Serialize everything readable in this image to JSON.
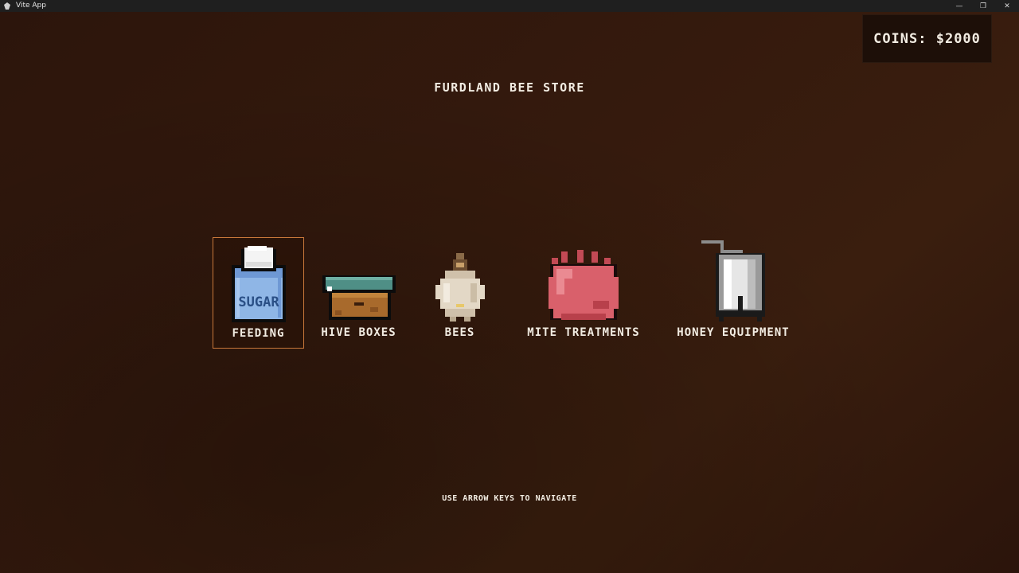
{
  "window": {
    "title": "Vite App",
    "controls": {
      "minimize": "—",
      "restore": "❐",
      "close": "✕"
    }
  },
  "hud": {
    "coins_label": "COINS: $2000"
  },
  "store": {
    "title": "FURDLAND BEE STORE",
    "selected_index": 0,
    "categories": [
      {
        "label": "FEEDING",
        "icon": "sugar-bag-icon"
      },
      {
        "label": "HIVE BOXES",
        "icon": "hive-box-icon"
      },
      {
        "label": "BEES",
        "icon": "bee-package-icon"
      },
      {
        "label": "MITE TREATMENTS",
        "icon": "mite-treatment-icon"
      },
      {
        "label": "HONEY EQUIPMENT",
        "icon": "honey-extractor-icon"
      }
    ]
  },
  "hint": "USE ARROW KEYS TO NAVIGATE",
  "colors": {
    "background": "#351a0d",
    "selection_border": "#c9783a",
    "text": "#f2ece2",
    "coins_panel": "#1d0f08"
  }
}
